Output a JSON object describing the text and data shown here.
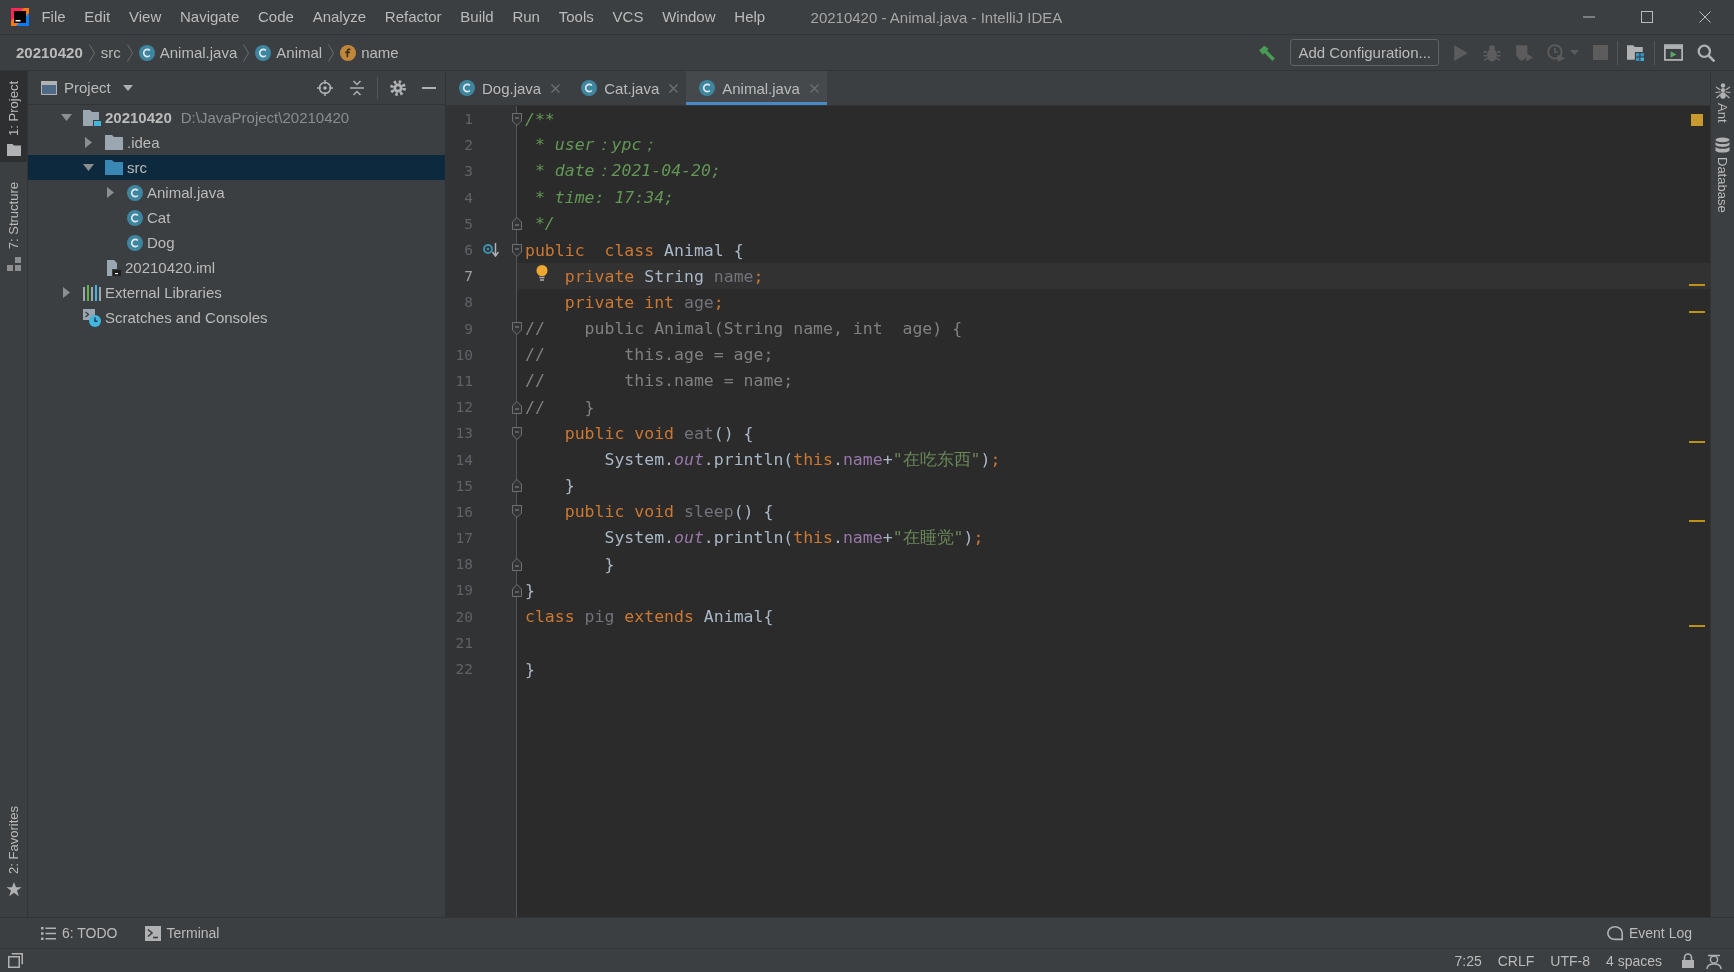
{
  "window": {
    "title": "20210420 - Animal.java - IntelliJ IDEA"
  },
  "menu": [
    "File",
    "Edit",
    "View",
    "Navigate",
    "Code",
    "Analyze",
    "Refactor",
    "Build",
    "Run",
    "Tools",
    "VCS",
    "Window",
    "Help"
  ],
  "navigation_bar": {
    "breadcrumbs": [
      {
        "label": "20210420",
        "kind": "project"
      },
      {
        "label": "src",
        "kind": "directory"
      },
      {
        "label": "Animal.java",
        "kind": "class_file"
      },
      {
        "label": "Animal",
        "kind": "class"
      },
      {
        "label": "name",
        "kind": "field"
      }
    ],
    "toolbar": [
      {
        "buttons": [
          {
            "kind": "build",
            "disabled": false
          },
          {
            "kind": "configuration",
            "label": "Add Configuration...",
            "disabled": false
          },
          {
            "kind": "run",
            "disabled": true
          },
          {
            "kind": "debug",
            "disabled": true
          },
          {
            "kind": "coverage",
            "disabled": true
          },
          {
            "kind": "profile",
            "disabled": true
          },
          {
            "kind": "stop",
            "disabled": true
          }
        ]
      },
      {
        "buttons": [
          {
            "kind": "project_structure",
            "disabled": false
          }
        ]
      },
      {
        "buttons": [
          {
            "kind": "terminal_window",
            "disabled": false
          },
          {
            "kind": "search",
            "disabled": false
          }
        ]
      }
    ]
  },
  "left_tool_strip": {
    "top": [
      {
        "label": "1: Project",
        "kind": "project",
        "selected": true
      },
      {
        "label": "7: Structure",
        "kind": "structure",
        "selected": false
      }
    ],
    "bottom": [
      {
        "label": "2: Favorites",
        "kind": "favorites",
        "selected": false
      }
    ]
  },
  "project_panel": {
    "title": "Project",
    "tree": [
      {
        "label": "20210420",
        "detail": "D:\\JavaProject\\20210420",
        "kind": "module",
        "expanded": true,
        "selected": false,
        "children": [
          {
            "label": ".idea",
            "kind": "folder",
            "expanded": false,
            "selected": false
          },
          {
            "label": "src",
            "kind": "source_folder",
            "expanded": true,
            "selected": true,
            "children": [
              {
                "label": "Animal.java",
                "kind": "class",
                "expanded": false,
                "selected": false
              },
              {
                "label": "Cat",
                "kind": "class",
                "selected": false
              },
              {
                "label": "Dog",
                "kind": "class",
                "selected": false
              }
            ]
          },
          {
            "label": "20210420.iml",
            "kind": "module_file",
            "selected": false
          }
        ]
      },
      {
        "label": "External Libraries",
        "kind": "libraries",
        "expanded": false,
        "selected": false
      },
      {
        "label": "Scratches and Consoles",
        "kind": "scratches",
        "selected": false
      }
    ]
  },
  "editor": {
    "tabs": [
      {
        "label": "Dog.java",
        "selected": false
      },
      {
        "label": "Cat.java",
        "selected": false
      },
      {
        "label": "Animal.java",
        "selected": true
      }
    ],
    "lines": [
      {
        "number": "1",
        "tokens": [
          {
            "text": "/**",
            "kind": "doc_comment"
          }
        ],
        "markers": [
          {
            "kind": "fold_start"
          }
        ],
        "current": false,
        "warning": false
      },
      {
        "number": "2",
        "tokens": [
          {
            "text": " * user：ypc；",
            "kind": "doc_comment"
          }
        ],
        "current": false,
        "warning": false
      },
      {
        "number": "3",
        "tokens": [
          {
            "text": " * date：2021-04-20;",
            "kind": "doc_comment"
          }
        ],
        "current": false,
        "warning": false
      },
      {
        "number": "4",
        "tokens": [
          {
            "text": " * time: 17:34;",
            "kind": "doc_comment"
          }
        ],
        "current": false,
        "warning": false
      },
      {
        "number": "5",
        "tokens": [
          {
            "text": " */",
            "kind": "doc_comment"
          }
        ],
        "markers": [
          {
            "kind": "fold_end"
          }
        ],
        "current": false,
        "warning": false
      },
      {
        "number": "6",
        "tokens": [
          {
            "text": "public",
            "kind": "keyword"
          },
          {
            "text": "  class",
            "kind": "keyword"
          },
          {
            "text": " Animal {",
            "kind": "plain"
          }
        ],
        "markers": [
          {
            "kind": "subclasses"
          },
          {
            "kind": "fold_start"
          }
        ],
        "current": false,
        "warning": false
      },
      {
        "number": "7",
        "tokens": [
          {
            "text": "    private",
            "kind": "keyword"
          },
          {
            "text": " String ",
            "kind": "plain"
          },
          {
            "text": "name",
            "kind": "unused"
          },
          {
            "text": ";",
            "kind": "keyword"
          }
        ],
        "markers": [
          {
            "kind": "bulb"
          }
        ],
        "current": true,
        "warning": true
      },
      {
        "number": "8",
        "tokens": [
          {
            "text": "    private",
            "kind": "keyword"
          },
          {
            "text": " int",
            "kind": "keyword"
          },
          {
            "text": " age",
            "kind": "unused"
          },
          {
            "text": ";",
            "kind": "keyword"
          }
        ],
        "current": false,
        "warning": true
      },
      {
        "number": "9",
        "tokens": [
          {
            "text": "//    public Animal(String name, int  age) {",
            "kind": "line_comment"
          }
        ],
        "markers": [
          {
            "kind": "fold_start"
          }
        ],
        "current": false,
        "warning": false
      },
      {
        "number": "10",
        "tokens": [
          {
            "text": "//        this.age = age;",
            "kind": "line_comment"
          }
        ],
        "current": false,
        "warning": false
      },
      {
        "number": "11",
        "tokens": [
          {
            "text": "//        this.name = name;",
            "kind": "line_comment"
          }
        ],
        "current": false,
        "warning": false
      },
      {
        "number": "12",
        "tokens": [
          {
            "text": "//    }",
            "kind": "line_comment"
          }
        ],
        "markers": [
          {
            "kind": "fold_end"
          }
        ],
        "current": false,
        "warning": false
      },
      {
        "number": "13",
        "tokens": [
          {
            "text": "    public",
            "kind": "keyword"
          },
          {
            "text": " void",
            "kind": "keyword"
          },
          {
            "text": " eat",
            "kind": "unused"
          },
          {
            "text": "() {",
            "kind": "plain"
          }
        ],
        "markers": [
          {
            "kind": "fold_start"
          }
        ],
        "current": false,
        "warning": true
      },
      {
        "number": "14",
        "tokens": [
          {
            "text": "        System.",
            "kind": "plain"
          },
          {
            "text": "out",
            "kind": "static_field"
          },
          {
            "text": ".println(",
            "kind": "plain"
          },
          {
            "text": "this",
            "kind": "keyword"
          },
          {
            "text": ".",
            "kind": "plain"
          },
          {
            "text": "name",
            "kind": "field"
          },
          {
            "text": "+",
            "kind": "plain"
          },
          {
            "text": "\"在吃东西\"",
            "kind": "string"
          },
          {
            "text": ")",
            "kind": "plain"
          },
          {
            "text": ";",
            "kind": "keyword"
          }
        ],
        "current": false,
        "warning": false
      },
      {
        "number": "15",
        "tokens": [
          {
            "text": "    }",
            "kind": "plain"
          }
        ],
        "markers": [
          {
            "kind": "fold_end"
          }
        ],
        "current": false,
        "warning": false
      },
      {
        "number": "16",
        "tokens": [
          {
            "text": "    public",
            "kind": "keyword"
          },
          {
            "text": " void",
            "kind": "keyword"
          },
          {
            "text": " sleep",
            "kind": "unused"
          },
          {
            "text": "() {",
            "kind": "plain"
          }
        ],
        "markers": [
          {
            "kind": "fold_start"
          }
        ],
        "current": false,
        "warning": true
      },
      {
        "number": "17",
        "tokens": [
          {
            "text": "        System.",
            "kind": "plain"
          },
          {
            "text": "out",
            "kind": "static_field"
          },
          {
            "text": ".println(",
            "kind": "plain"
          },
          {
            "text": "this",
            "kind": "keyword"
          },
          {
            "text": ".",
            "kind": "plain"
          },
          {
            "text": "name",
            "kind": "field"
          },
          {
            "text": "+",
            "kind": "plain"
          },
          {
            "text": "\"在睡觉\"",
            "kind": "string"
          },
          {
            "text": ")",
            "kind": "plain"
          },
          {
            "text": ";",
            "kind": "keyword"
          }
        ],
        "current": false,
        "warning": false
      },
      {
        "number": "18",
        "tokens": [
          {
            "text": "        }",
            "kind": "plain"
          }
        ],
        "markers": [
          {
            "kind": "fold_end"
          }
        ],
        "current": false,
        "warning": false
      },
      {
        "number": "19",
        "tokens": [
          {
            "text": "}",
            "kind": "plain"
          }
        ],
        "markers": [
          {
            "kind": "fold_end"
          }
        ],
        "current": false,
        "warning": false
      },
      {
        "number": "20",
        "tokens": [
          {
            "text": "class",
            "kind": "keyword"
          },
          {
            "text": " pig",
            "kind": "unused"
          },
          {
            "text": " extends",
            "kind": "keyword"
          },
          {
            "text": " Animal{",
            "kind": "plain"
          }
        ],
        "current": false,
        "warning": true
      },
      {
        "number": "21",
        "current": false,
        "warning": false
      },
      {
        "number": "22",
        "tokens": [
          {
            "text": "}",
            "kind": "plain"
          }
        ],
        "current": false,
        "warning": false
      }
    ]
  },
  "right_tool_strip": [
    {
      "label": "Ant",
      "kind": "ant"
    },
    {
      "label": "Database",
      "kind": "database"
    }
  ],
  "bottom_tool_bar": {
    "left": [
      {
        "label": "6: TODO",
        "kind": "todo"
      },
      {
        "label": "Terminal",
        "kind": "terminal"
      }
    ],
    "right": [
      {
        "label": "Event Log",
        "kind": "event_log"
      }
    ]
  },
  "status_bar": {
    "caret_position": "7:25",
    "line_separator": "CRLF",
    "encoding": "UTF-8",
    "indentation": "4 spaces"
  }
}
